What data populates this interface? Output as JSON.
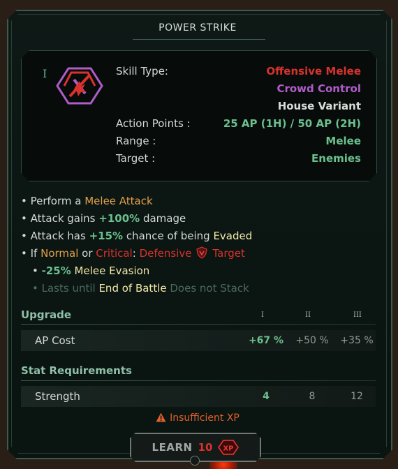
{
  "title": "POWER STRIKE",
  "tier_mark": "I",
  "icon": "power-strike-skill-icon",
  "info": {
    "skill_type_label": "Skill Type:",
    "skill_type_values": [
      "Offensive Melee",
      "Crowd Control",
      "House Variant"
    ],
    "ap_label": "Action Points :",
    "ap_value": "25 AP  (1H)  /  50 AP  (2H)",
    "range_label": "Range :",
    "range_value": "Melee",
    "target_label": "Target :",
    "target_value": "Enemies"
  },
  "bullets": {
    "b1_prefix": "• Perform a ",
    "b1_hl": "Melee Attack",
    "b2_prefix": "• Attack gains ",
    "b2_hl": "+100%",
    "b2_suffix": " damage",
    "b3_prefix": "• Attack has ",
    "b3_hl": "+15%",
    "b3_mid": " chance of being ",
    "b3_hl2": "Evaded",
    "b4_prefix": "• If ",
    "b4_normal": "Normal",
    "b4_or": " or ",
    "b4_critical": "Critical",
    "b4_colon": ": ",
    "b4_defensive": "Defensive",
    "b4_target": "Target",
    "b5_prefix": "• ",
    "b5_hl": "-25%",
    "b5_suffix": " Melee Evasion",
    "b6_prefix": "• Lasts until ",
    "b6_hl": "End of Battle",
    "b6_suffix": " Does not Stack"
  },
  "upgrade": {
    "heading": "Upgrade",
    "tiers": [
      "I",
      "II",
      "III"
    ],
    "row_label": "AP Cost",
    "values": [
      "+67 %",
      "+50 %",
      "+35 %"
    ]
  },
  "requirements": {
    "heading": "Stat Requirements",
    "row_label": "Strength",
    "values": [
      "4",
      "8",
      "12"
    ]
  },
  "warning": "Insufficient XP",
  "learn": {
    "label": "LEARN",
    "cost": "10",
    "currency": "XP"
  },
  "colors": {
    "offensive": "#d8322e",
    "crowd_control": "#b05cc9",
    "positive": "#6cbf8f",
    "highlight": "#e2a04a",
    "warning": "#e0602c"
  }
}
